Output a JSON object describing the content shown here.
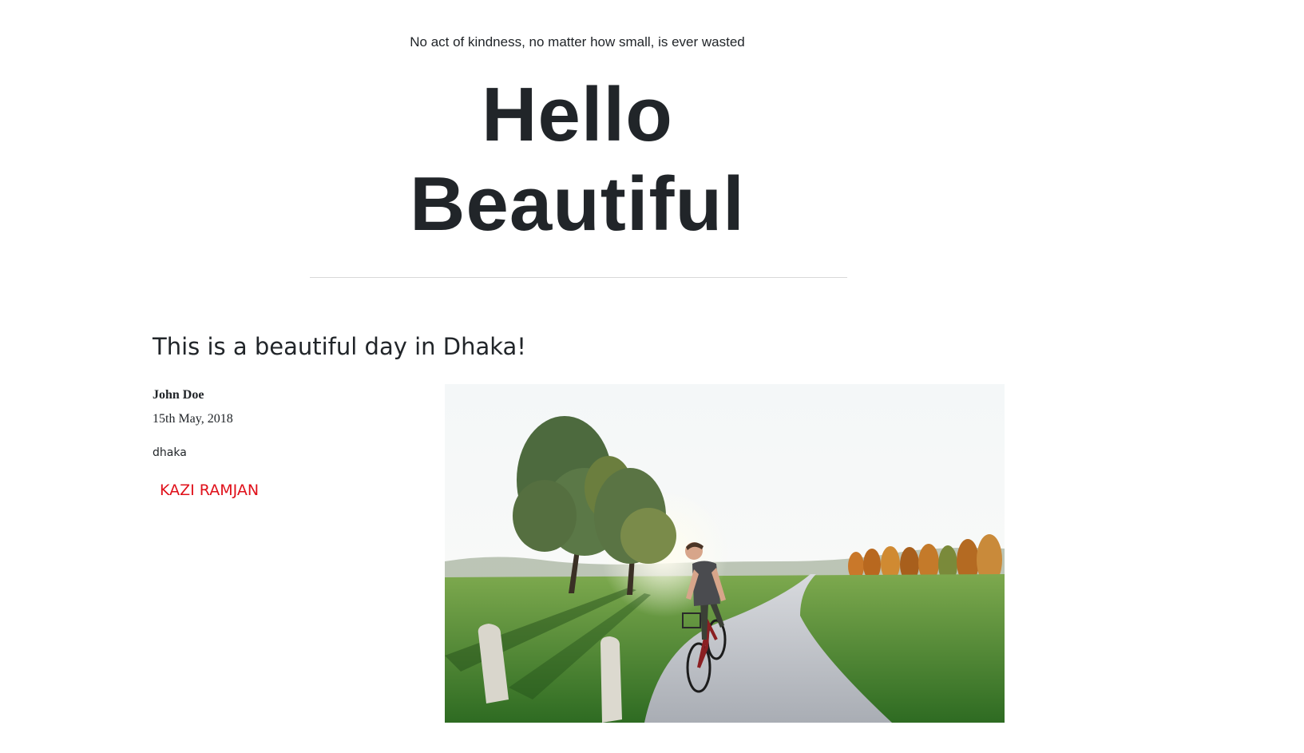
{
  "header": {
    "tagline": "No act of kindness, no matter how small, is ever wasted",
    "title_line1": "Hello",
    "title_line2": "Beautiful"
  },
  "post": {
    "title": "This is a beautiful day in Dhaka!",
    "author": "John Doe",
    "date": "15th May, 2018",
    "location": "dhaka",
    "signature": "KAZI RAMJAN"
  },
  "colors": {
    "text": "#212529",
    "signature": "#e0101a",
    "divider": "#d9d9d9"
  }
}
